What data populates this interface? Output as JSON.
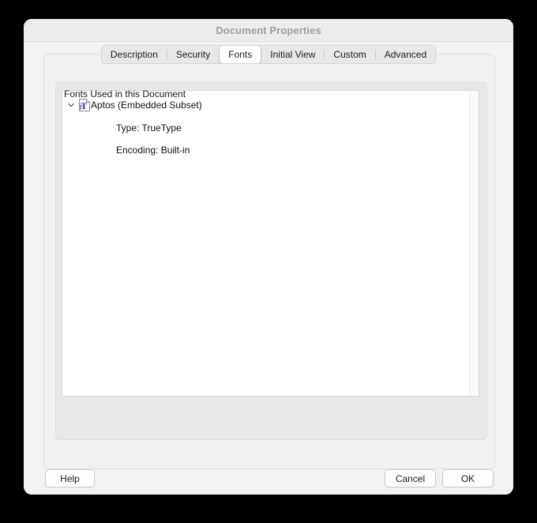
{
  "window": {
    "title": "Document Properties"
  },
  "tabs": {
    "items": [
      {
        "label": "Description",
        "selected": false
      },
      {
        "label": "Security",
        "selected": false
      },
      {
        "label": "Fonts",
        "selected": true
      },
      {
        "label": "Initial View",
        "selected": false
      },
      {
        "label": "Custom",
        "selected": false
      },
      {
        "label": "Advanced",
        "selected": false
      }
    ]
  },
  "fonts_panel": {
    "group_label": "Fonts Used in this Document",
    "tree": {
      "chevron_icon": "chevron-down-icon",
      "font_icon": "truetype-font-icon",
      "font_name": "Aptos (Embedded Subset)",
      "details": [
        "Type: TrueType",
        "Encoding: Built-in"
      ]
    }
  },
  "footer": {
    "help_label": "Help",
    "cancel_label": "Cancel",
    "ok_label": "OK"
  },
  "colors": {
    "window_bg": "#f2f2f2",
    "titlebar_bg": "#ececec",
    "title_text": "#9d9d9d",
    "panel_bg": "#f0f0f0",
    "groupbox_bg": "#e8e8e8",
    "list_bg": "#ffffff",
    "font_icon_letter": "#2222cc"
  }
}
